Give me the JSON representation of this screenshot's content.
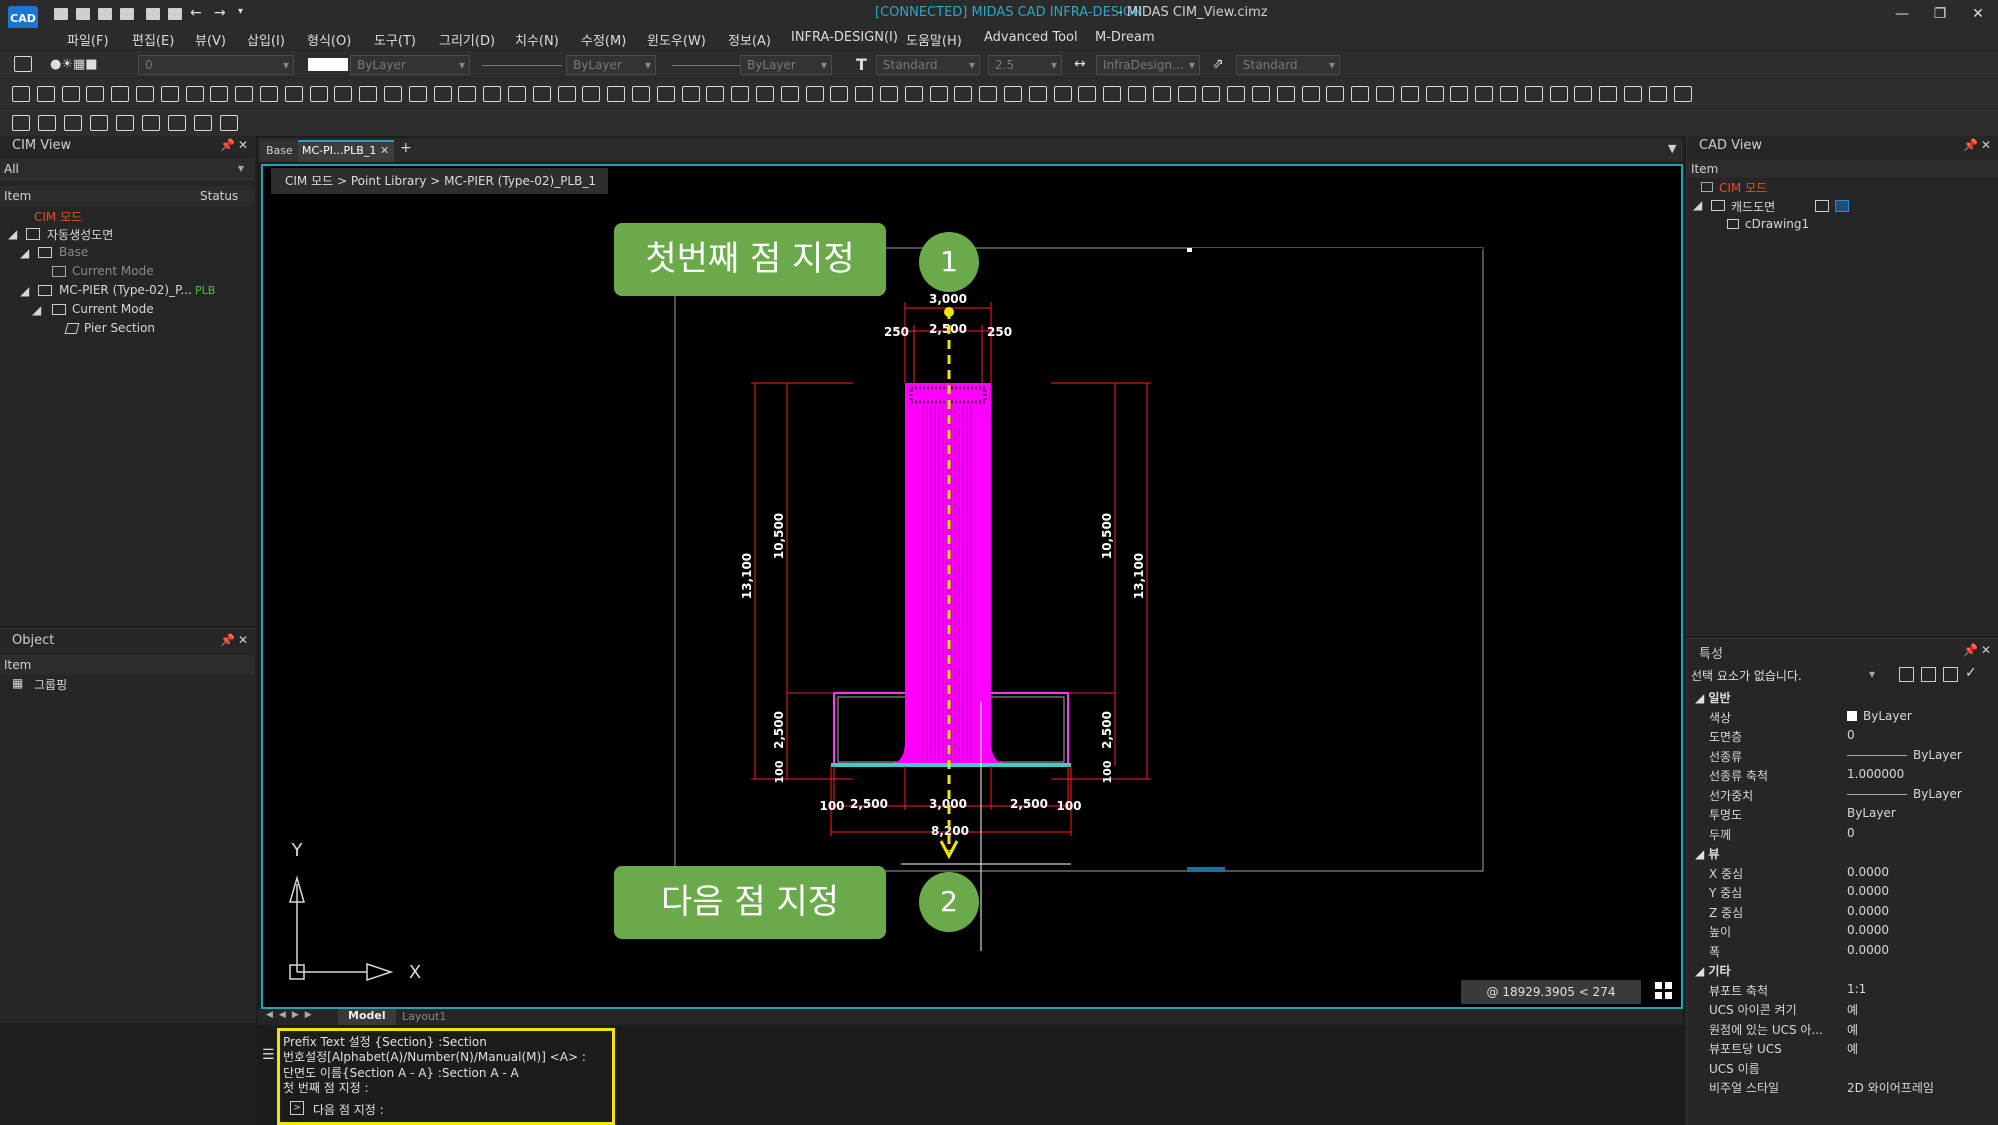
{
  "titlebar": {
    "app_logo": "CAD",
    "connected": "[CONNECTED] MIDAS CAD INFRA-DESIGN",
    "file": "- MIDAS CIM_View.cimz",
    "minimize": "—",
    "restore": "❐",
    "close": "✕"
  },
  "menu": [
    "파일(F)",
    "편집(E)",
    "뷰(V)",
    "삽입(I)",
    "형식(O)",
    "도구(T)",
    "그리기(D)",
    "치수(N)",
    "수정(M)",
    "윈도우(W)",
    "정보(A)",
    "INFRA-DESIGN(I)",
    "도움말(H)",
    "Advanced Tool",
    "M-Dream"
  ],
  "toolbar": {
    "layer_value": "0",
    "color_value": "ByLayer",
    "linetype_value": "ByLayer",
    "lineweight_value": "ByLayer",
    "textstyle_value": "Standard",
    "textsize_value": "2.5",
    "dimstyle_value": "InfraDesign...",
    "tablestyle_value": "Standard"
  },
  "cim_view": {
    "title": "CIM View",
    "filter": "All",
    "col_item": "Item",
    "col_status": "Status",
    "tree": [
      {
        "label": "CIM 모드",
        "color": "#e0502a"
      },
      {
        "label": "자동생성도면"
      },
      {
        "label": "Base",
        "dim": true
      },
      {
        "label": "Current Mode",
        "dim": true
      },
      {
        "label": "MC-PIER (Type-02)_P...",
        "status": "PLB"
      },
      {
        "label": "Current Mode"
      },
      {
        "label": "Pier Section"
      }
    ]
  },
  "object_panel": {
    "title": "Object",
    "col_item": "Item",
    "tree": [
      "그룹핑"
    ]
  },
  "tabs": {
    "base": "Base",
    "active": "MC-PI...PLB_1",
    "close": "✕",
    "add": "+"
  },
  "breadcrumb": "CIM 모드 > Point Library > MC-PIER (Type-02)_PLB_1",
  "drawing": {
    "dims": {
      "top_total": "3,000",
      "top_left": "250",
      "top_mid": "2,500",
      "top_right": "250",
      "left_outer": "13,100",
      "left_inner": "10,500",
      "right_inner": "10,500",
      "right_outer": "13,100",
      "left_footing": "2,500",
      "left_base": "100",
      "right_footing": "2,500",
      "right_base": "100",
      "bot_1": "100",
      "bot_2": "2,500",
      "bot_3": "3,000",
      "bot_4": "2,500",
      "bot_5": "100",
      "bot_total": "8,200"
    },
    "ucs_y": "Y",
    "ucs_x": "X"
  },
  "callouts": {
    "first": "첫번째 점 지정",
    "first_num": "1",
    "next": "다음 점 지정",
    "next_num": "2"
  },
  "coords": "@ 18929.3905 < 274",
  "layout_tabs": {
    "model": "Model",
    "layout1": "Layout1"
  },
  "command": {
    "lines": [
      "Prefix Text 설정 {Section} :Section",
      "번호설정[Alphabet(A)/Number(N)/Manual(M)] <A> :",
      "단면도 이름{Section A - A} :Section A - A",
      "첫 번째 점 지정 :"
    ],
    "prompt": "다음 점 지정 :"
  },
  "cad_view": {
    "title": "CAD View",
    "col_item": "Item",
    "tree": [
      {
        "label": "CIM 모드",
        "color": "#e0502a"
      },
      {
        "label": "캐드도면"
      },
      {
        "label": "cDrawing1"
      }
    ]
  },
  "properties": {
    "title": "특성",
    "selection": "선택 요소가 없습니다.",
    "sections": [
      {
        "name": "일반",
        "rows": [
          [
            "색상",
            "ByLayer"
          ],
          [
            "도면층",
            "0"
          ],
          [
            "선종류",
            "ByLayer"
          ],
          [
            "선종류 축척",
            "1.000000"
          ],
          [
            "선가중치",
            "ByLayer"
          ],
          [
            "투명도",
            "ByLayer"
          ],
          [
            "두께",
            "0"
          ]
        ]
      },
      {
        "name": "뷰",
        "rows": [
          [
            "X 중심",
            "0.0000"
          ],
          [
            "Y 중심",
            "0.0000"
          ],
          [
            "Z 중심",
            "0.0000"
          ],
          [
            "높이",
            "0.0000"
          ],
          [
            "폭",
            "0.0000"
          ]
        ]
      },
      {
        "name": "기타",
        "rows": [
          [
            "뷰포트 축척",
            "1:1"
          ],
          [
            "UCS 아이콘 켜기",
            "예"
          ],
          [
            "원점에 있는 UCS 아...",
            "예"
          ],
          [
            "뷰포트당 UCS",
            "예"
          ],
          [
            "UCS 이름",
            ""
          ],
          [
            "비주얼 스타일",
            "2D 와이어프레임"
          ]
        ]
      }
    ]
  },
  "colors": {
    "accent": "#1aa5b8",
    "callout_green": "#6aaa4a",
    "highlight_yellow": "#f2e600",
    "pier_magenta": "#ff00ff",
    "dim_red": "#ff2020"
  }
}
